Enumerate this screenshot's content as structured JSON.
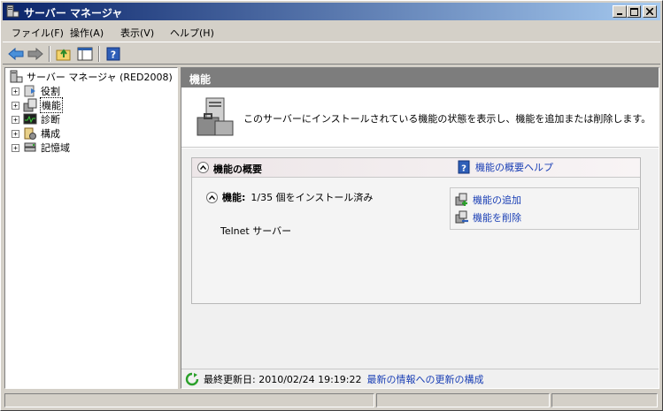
{
  "window": {
    "title": "サーバー マネージャ",
    "icon": "server-manager-icon"
  },
  "menu": [
    "ファイル(F)",
    "操作(A)",
    "表示(V)",
    "ヘルプ(H)"
  ],
  "toolbar": {
    "buttons": [
      "back-arrow-icon",
      "forward-arrow-icon",
      "up-folder-icon",
      "show-hide-tree-icon",
      "help-icon"
    ]
  },
  "tree": {
    "root": "サーバー マネージャ (RED2008)",
    "items": [
      {
        "label": "役割",
        "icon": "roles-icon",
        "expander": "+"
      },
      {
        "label": "機能",
        "icon": "features-icon",
        "expander": "+",
        "selected": true
      },
      {
        "label": "診断",
        "icon": "diagnostics-icon",
        "expander": "+"
      },
      {
        "label": "構成",
        "icon": "configuration-icon",
        "expander": "+"
      },
      {
        "label": "記憶域",
        "icon": "storage-icon",
        "expander": "+"
      }
    ]
  },
  "panel": {
    "header": "機能",
    "description": "このサーバーにインストールされている機能の状態を表示し、機能を追加または削除します。",
    "section": {
      "title": "機能の概要",
      "help_link": "機能の概要ヘルプ",
      "status_label": "機能:",
      "status_text": "1/35 個をインストール済み",
      "installed_features": [
        "Telnet サーバー"
      ],
      "actions": [
        "機能の追加",
        "機能を削除"
      ]
    },
    "footer": {
      "last_updated": "最終更新日: 2010/02/24 19:19:22",
      "refresh_link": "最新の情報への更新の構成"
    }
  },
  "colors": {
    "titlebar_start": "#0a246a",
    "titlebar_end": "#a6caf0",
    "header_gray": "#7d7d7d",
    "link_blue": "#1a3fb5"
  }
}
